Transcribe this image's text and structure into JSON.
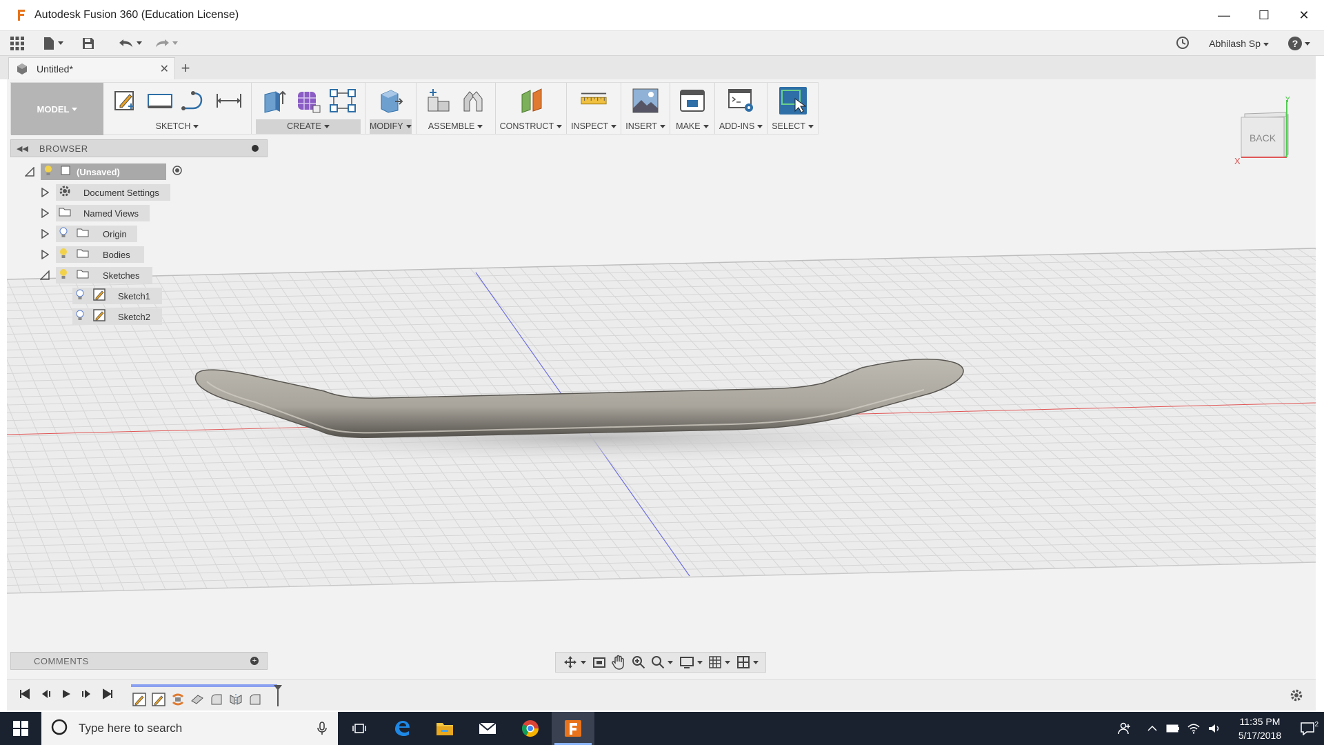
{
  "window": {
    "title": "Autodesk Fusion 360 (Education License)",
    "minimize": "—",
    "maximize": "☐",
    "close": "✕"
  },
  "quick_access": {
    "user": "Abhilash Sp",
    "help": "?"
  },
  "document_tab": {
    "label": "Untitled*",
    "close": "✕",
    "new_tab": "+"
  },
  "toolbar": {
    "workspace": "MODEL",
    "groups": [
      {
        "label": "SKETCH"
      },
      {
        "label": "CREATE"
      },
      {
        "label": "MODIFY"
      },
      {
        "label": "ASSEMBLE"
      },
      {
        "label": "CONSTRUCT"
      },
      {
        "label": "INSPECT"
      },
      {
        "label": "INSERT"
      },
      {
        "label": "MAKE"
      },
      {
        "label": "ADD-INS"
      },
      {
        "label": "SELECT"
      }
    ]
  },
  "viewcube": {
    "face": "BACK",
    "axis_x": "X",
    "axis_y": "Y"
  },
  "browser": {
    "title": "BROWSER",
    "items": [
      {
        "label": "(Unsaved)"
      },
      {
        "label": "Document Settings"
      },
      {
        "label": "Named Views"
      },
      {
        "label": "Origin"
      },
      {
        "label": "Bodies"
      },
      {
        "label": "Sketches"
      },
      {
        "label": "Sketch1"
      },
      {
        "label": "Sketch2"
      }
    ]
  },
  "comments": {
    "title": "COMMENTS",
    "add": "+"
  },
  "taskbar": {
    "search_placeholder": "Type here to search",
    "time": "11:35 PM",
    "date": "5/17/2018",
    "notification_count": "2"
  },
  "colors": {
    "accent": "#2e6fa8",
    "taskbar": "#1a2230",
    "canvas": "#f2f2f2",
    "x_axis": "#e05555",
    "z_axis": "#6f6fe0",
    "y_axis": "#55cc55"
  }
}
